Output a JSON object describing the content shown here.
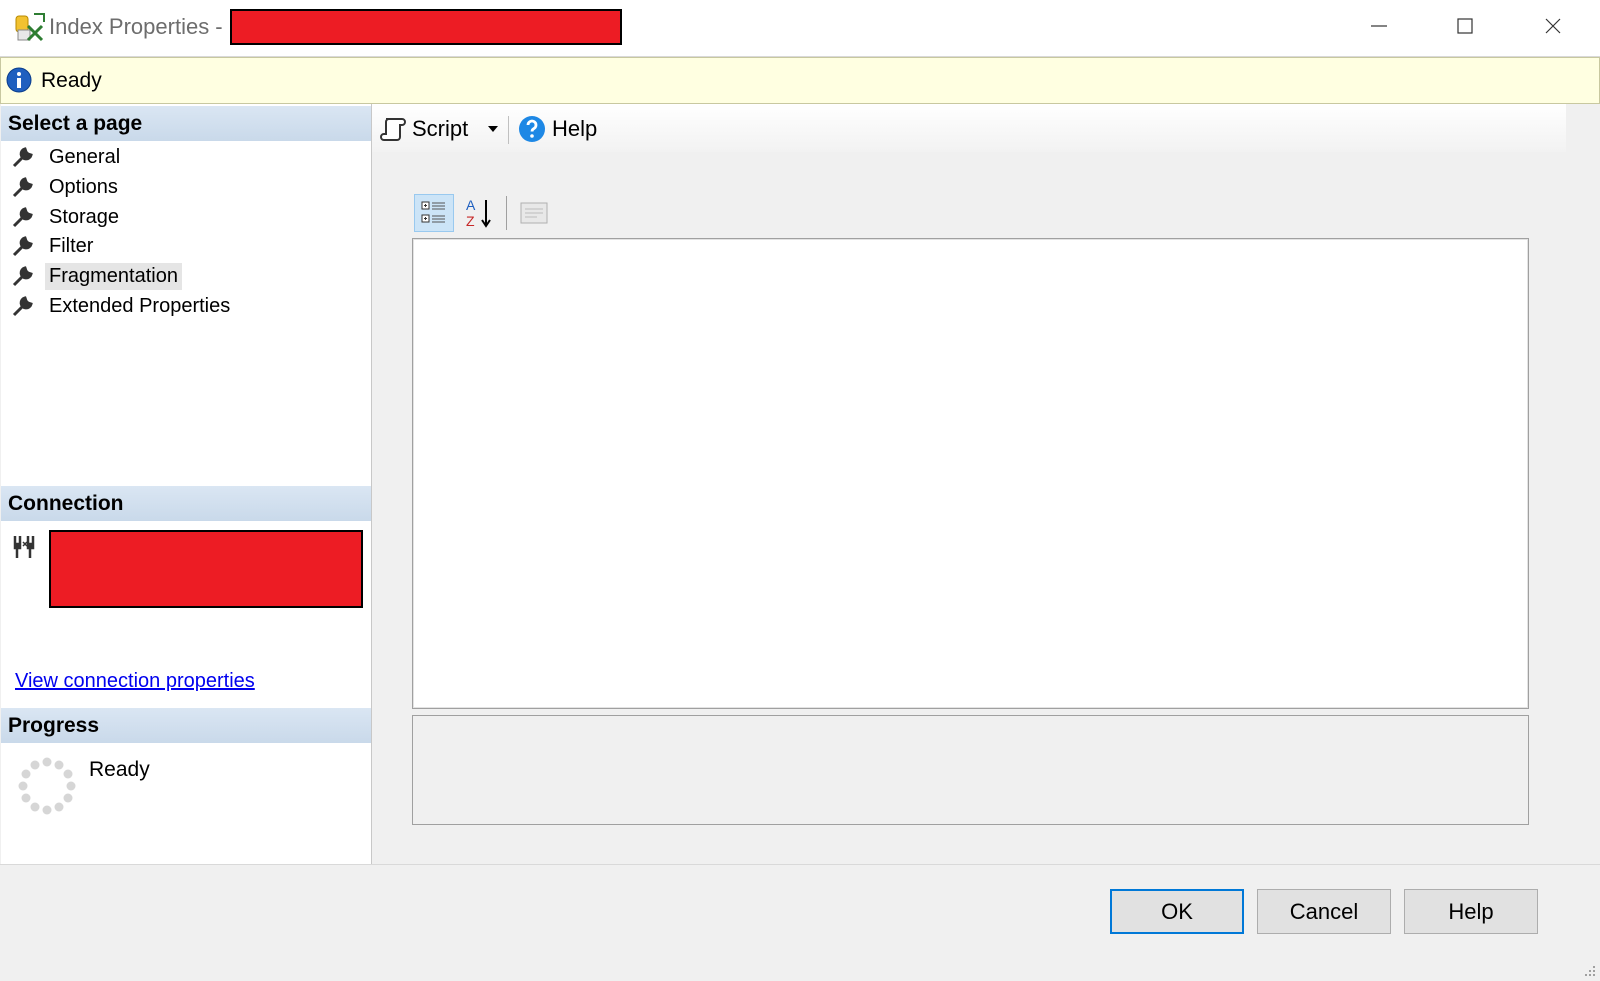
{
  "window": {
    "title": "Index Properties -",
    "controls": {
      "minimize": "minimize-icon",
      "maximize": "maximize-icon",
      "close": "close-icon"
    }
  },
  "infobar": {
    "status": "Ready"
  },
  "left": {
    "select_page_header": "Select a page",
    "pages": [
      {
        "label": "General",
        "selected": false
      },
      {
        "label": "Options",
        "selected": false
      },
      {
        "label": "Storage",
        "selected": false
      },
      {
        "label": "Filter",
        "selected": false
      },
      {
        "label": "Fragmentation",
        "selected": true
      },
      {
        "label": "Extended Properties",
        "selected": false
      }
    ],
    "connection_header": "Connection",
    "view_connection_link": "View connection properties",
    "progress_header": "Progress",
    "progress_status": "Ready"
  },
  "toolbar": {
    "script_label": "Script",
    "help_label": "Help"
  },
  "buttons": {
    "ok": "OK",
    "cancel": "Cancel",
    "help": "Help"
  },
  "colors": {
    "accent": "#0078d7",
    "redaction": "#ed1c24",
    "section_header": "#dae6f3",
    "infobar": "#ffffe1",
    "link": "#0000ee"
  }
}
